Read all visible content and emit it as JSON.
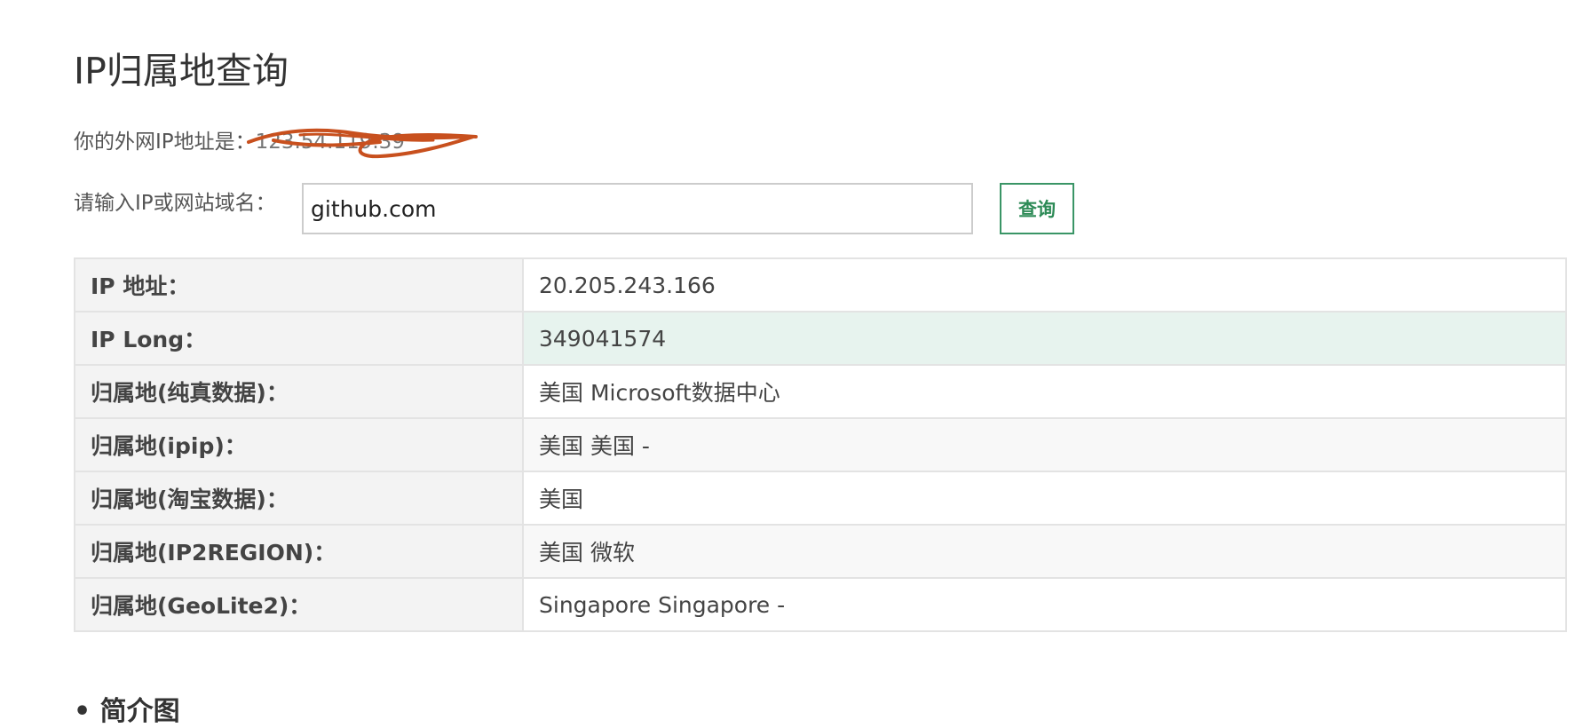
{
  "page": {
    "title": "IP归属地查询"
  },
  "my_ip": {
    "label": "你的外网IP地址是：",
    "value": "123.54.119.39"
  },
  "query": {
    "label": "请输入IP或网站域名：",
    "input_value": "github.com",
    "button_label": "查询"
  },
  "results": [
    {
      "key": "IP 地址：",
      "value": "20.205.243.166"
    },
    {
      "key": "IP Long：",
      "value": "349041574"
    },
    {
      "key": "归属地(纯真数据)：",
      "value": "美国 Microsoft数据中心"
    },
    {
      "key": "归属地(ipip)：",
      "value": "美国 美国 -"
    },
    {
      "key": "归属地(淘宝数据)：",
      "value": "美国"
    },
    {
      "key": "归属地(IP2REGION)：",
      "value": "美国 微软"
    },
    {
      "key": "归属地(GeoLite2)：",
      "value": "Singapore Singapore -"
    }
  ],
  "next_section": {
    "title": "• 简介图"
  },
  "colors": {
    "accent": "#2e8b57",
    "highlight_row": "#e7f3ee",
    "scribble": "#c8501e"
  }
}
